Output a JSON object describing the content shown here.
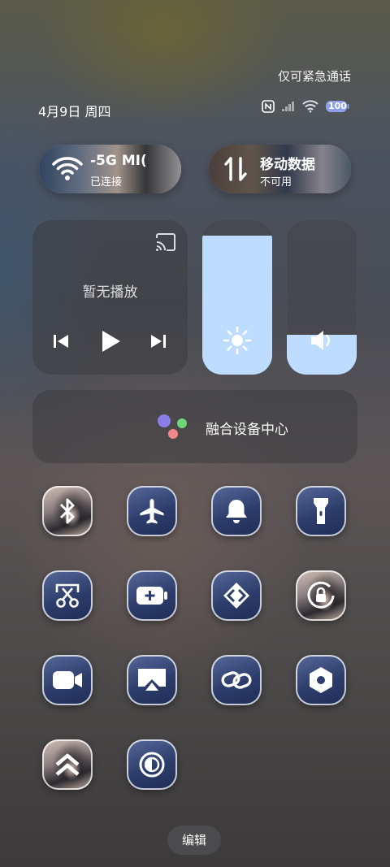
{
  "status": {
    "emergency_text": "仅可紧急通话",
    "date_text": "4月9日 周四",
    "battery_level": "100",
    "icons": [
      "nfc-icon",
      "signal-icon",
      "wifi-icon",
      "battery-icon"
    ]
  },
  "wifi_pill": {
    "title": "-5G MI(",
    "subtitle": "已连接",
    "icon": "wifi-icon"
  },
  "data_pill": {
    "title": "移动数据",
    "subtitle": "不可用",
    "icon": "arrows-icon"
  },
  "media": {
    "message": "暂无播放",
    "icons": [
      "cast-icon",
      "previous-icon",
      "play-icon",
      "next-icon"
    ]
  },
  "brightness": {
    "level": 0.9,
    "icon": "sun-icon"
  },
  "volume": {
    "level": 0.26,
    "icon": "speaker-icon"
  },
  "hub": {
    "label": "融合设备中心"
  },
  "toggles": [
    {
      "name": "bluetooth",
      "icon": "bluetooth-icon"
    },
    {
      "name": "airplane",
      "icon": "airplane-icon"
    },
    {
      "name": "bell",
      "icon": "bell-icon"
    },
    {
      "name": "flashlight",
      "icon": "flashlight-icon"
    },
    {
      "name": "screenshot",
      "icon": "scissors-icon"
    },
    {
      "name": "battery-saver",
      "icon": "battery-plus-icon"
    },
    {
      "name": "nearby-share",
      "icon": "share-icon"
    },
    {
      "name": "rotation-lock",
      "icon": "rotation-lock-icon"
    },
    {
      "name": "screen-record",
      "icon": "video-icon"
    },
    {
      "name": "screen-cast",
      "icon": "cast-screen-icon"
    },
    {
      "name": "link",
      "icon": "link-icon"
    },
    {
      "name": "settings",
      "icon": "hexagon-settings-icon"
    },
    {
      "name": "double-up",
      "icon": "double-chevron-up-icon"
    },
    {
      "name": "dark-mode",
      "icon": "contrast-icon"
    }
  ],
  "edit_label": "编辑",
  "colors": {
    "slider_fill": "#bedcff",
    "toggle_blue": "#2d3d6b"
  }
}
